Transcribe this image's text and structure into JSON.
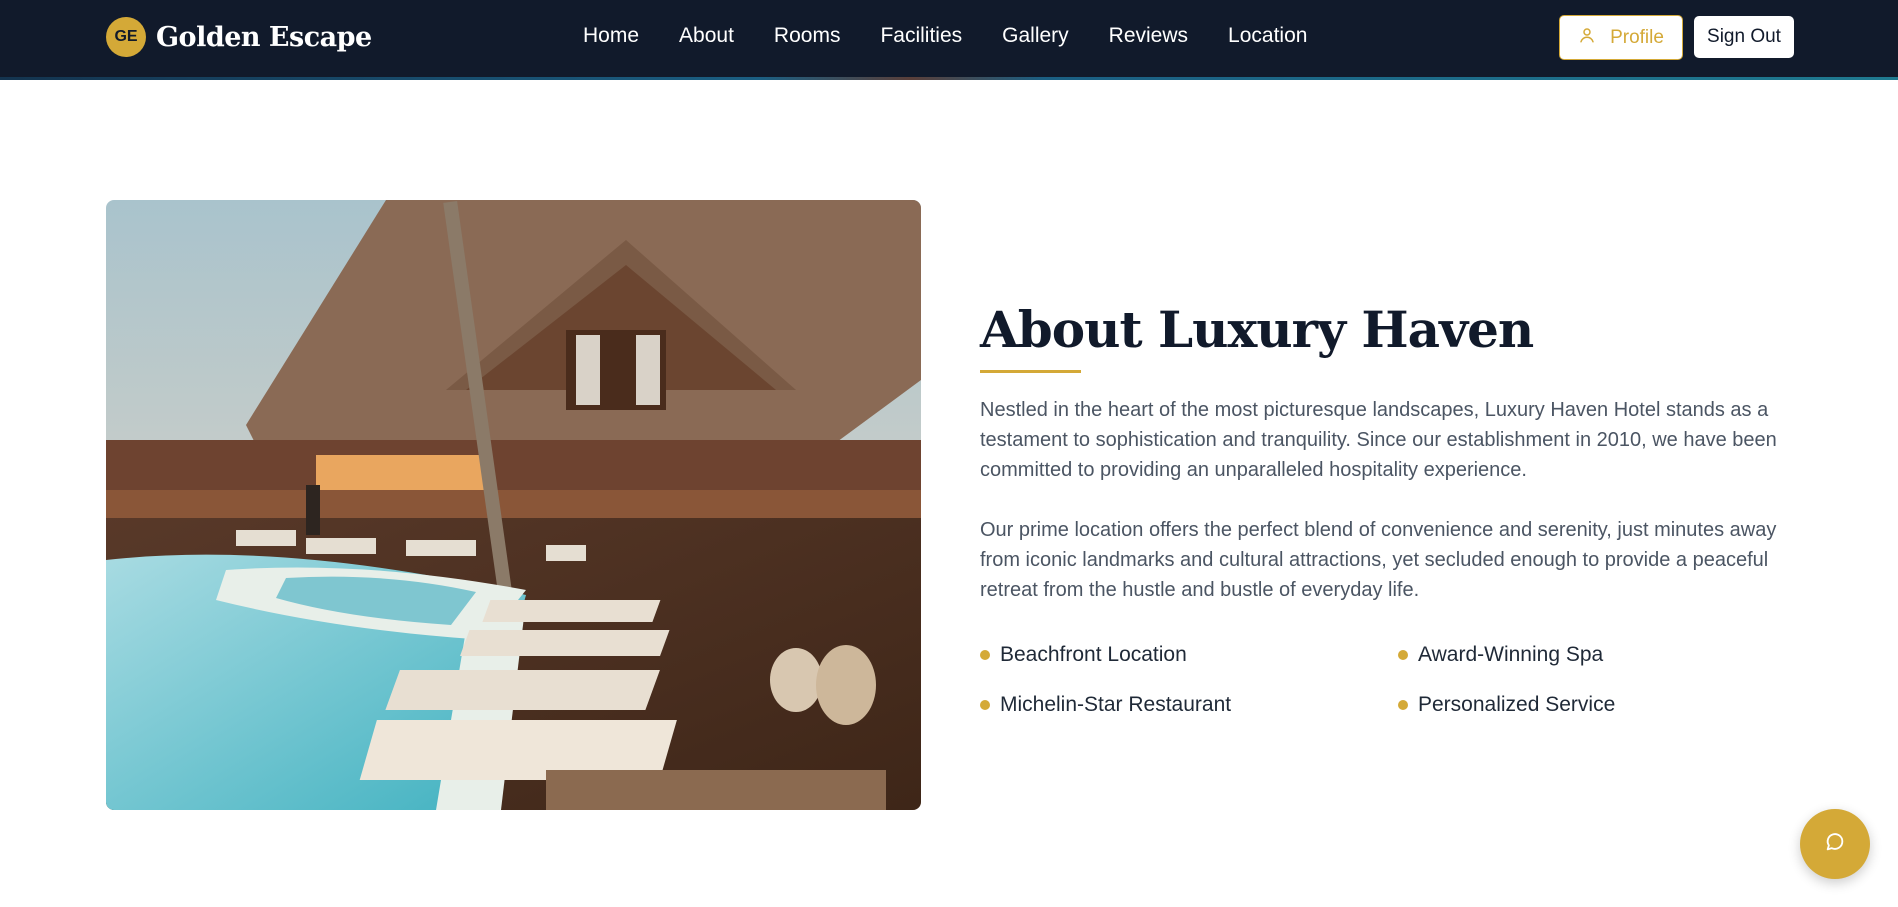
{
  "header": {
    "logo_initials": "GE",
    "brand_name": "Golden Escape",
    "nav": [
      "Home",
      "About",
      "Rooms",
      "Facilities",
      "Gallery",
      "Reviews",
      "Location"
    ],
    "profile_label": "Profile",
    "profile_icon": "user-icon",
    "signout_label": "Sign Out"
  },
  "about": {
    "title": "About Luxury Haven",
    "paragraphs": [
      "Nestled in the heart of the most picturesque landscapes, Luxury Haven Hotel stands as a testament to sophistication and tranquility. Since our establishment in 2010, we have been committed to providing an unparalleled hospitality experience.",
      "Our prime location offers the perfect blend of convenience and serenity, just minutes away from iconic landmarks and cultural attractions, yet secluded enough to provide a peaceful retreat from the hustle and bustle of everyday life."
    ],
    "features": [
      "Beachfront Location",
      "Award-Winning Spa",
      "Michelin-Star Restaurant",
      "Personalized Service"
    ]
  },
  "chat": {
    "icon": "chat-bubble-icon"
  },
  "colors": {
    "navy": "#111a2b",
    "gold": "#d4a937",
    "text_gray": "#4b5563",
    "white": "#ffffff"
  }
}
